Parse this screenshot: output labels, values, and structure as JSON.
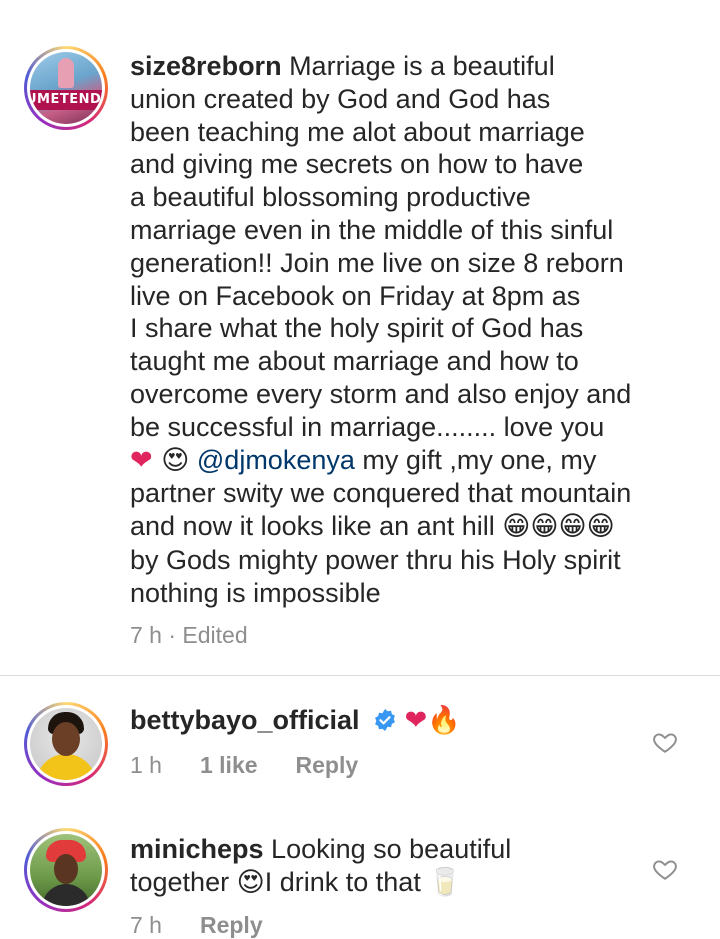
{
  "post": {
    "username": "size8reborn",
    "avatar_label": "UMETENDA",
    "lines": [
      " Marriage is a beautiful",
      "union created by God and God has",
      "been teaching me alot about marriage",
      "and giving me secrets on how to have",
      "a beautiful blossoming productive",
      "marriage even in the middle of this sinful",
      "generation!! Join me live on size 8 reborn",
      "live on Facebook on Friday at 8pm as",
      "I share what the holy spirit of God has",
      "taught me about marriage and how to",
      "overcome every storm and also enjoy and",
      "be successful in marriage........ love you"
    ],
    "emoji_line_prefix": "❤ ",
    "emoji_line_emoji2": "😍",
    "mention": "@djmokenya",
    "emoji_line_rest": " my gift ,my one, my",
    "line_after_1": "partner swity we conquered that mountain",
    "line_after_2_text": "and now it looks like an ant hill ",
    "line_after_2_emoji": "😁😁😁😁",
    "line_after_3": "by Gods mighty power thru his Holy spirit",
    "line_after_4": "nothing is impossible",
    "meta": "7 h · Edited"
  },
  "comments": [
    {
      "username": "bettybayo_official",
      "verified_icon": "verified-badge-icon",
      "emojis": "❤🔥",
      "time": "1 h",
      "likes": "1 like",
      "reply": "Reply",
      "like_icon": "heart-outline-icon"
    },
    {
      "username": "minicheps",
      "text_line1": " Looking so beautiful",
      "text_line2_a": "together ",
      "text_line2_emoji": "😍",
      "text_line2_b": "I drink to that ",
      "text_line2_emoji2": "🥛",
      "time": "7 h",
      "reply": "Reply",
      "like_icon": "heart-outline-icon"
    }
  ],
  "colors": {
    "text": "#262626",
    "secondary": "#8e8e8e",
    "mention": "#00376b",
    "verified": "#3897f0",
    "heart": "#e0245e"
  }
}
